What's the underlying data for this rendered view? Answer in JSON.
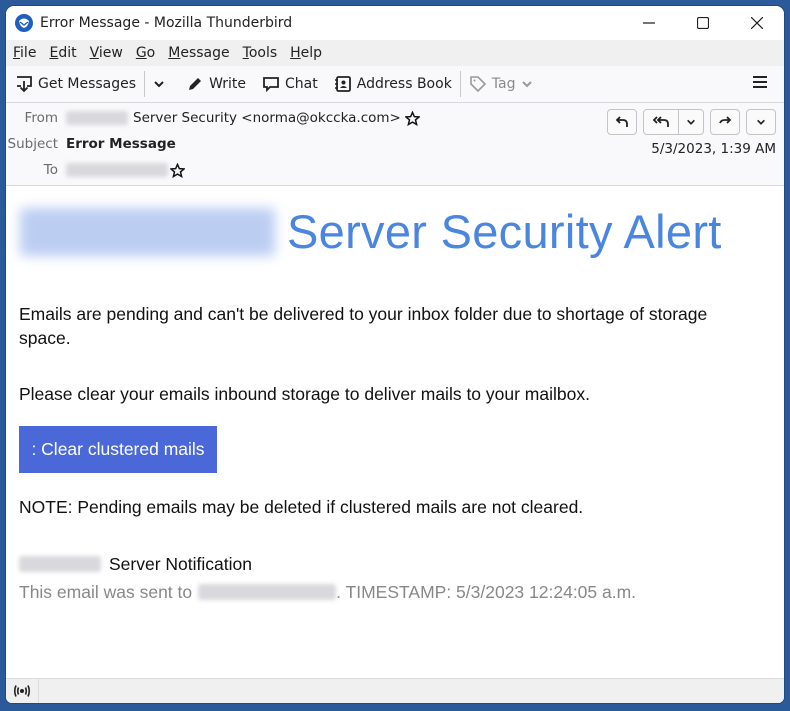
{
  "window": {
    "title": "Error Message - Mozilla Thunderbird"
  },
  "menu": {
    "items": [
      {
        "label": "File",
        "accel": "F",
        "rest": "ile"
      },
      {
        "label": "Edit",
        "accel": "E",
        "rest": "dit"
      },
      {
        "label": "View",
        "accel": "V",
        "rest": "iew"
      },
      {
        "label": "Go",
        "accel": "G",
        "rest": "o"
      },
      {
        "label": "Message",
        "accel": "M",
        "rest": "essage"
      },
      {
        "label": "Tools",
        "accel": "T",
        "rest": "ools"
      },
      {
        "label": "Help",
        "accel": "H",
        "rest": "elp"
      }
    ]
  },
  "toolbar": {
    "get_messages": "Get Messages",
    "write": "Write",
    "chat": "Chat",
    "address_book": "Address Book",
    "tag": "Tag"
  },
  "header": {
    "from_label": "From",
    "from_value": "Server Security <norma@okccka.com>",
    "subject_label": "Subject",
    "subject_value": "Error Message",
    "to_label": "To",
    "date": "5/3/2023, 1:39 AM"
  },
  "email": {
    "title": "Server Security Alert",
    "para1_line1": "Emails are pending and can't be delivered to your inbox folder due to shortage of storage",
    "para1_line2": "space.",
    "para2": "Please clear your emails inbound storage to deliver mails to your mailbox.",
    "button": ": Clear clustered mails",
    "note": "NOTE: Pending emails may be deleted if clustered mails are not cleared.",
    "signature": "Server Notification",
    "footer_prefix": "This email was sent to",
    "footer_suffix": ". TIMESTAMP: 5/3/2023 12:24:05 a.m."
  },
  "colors": {
    "accent": "#4a86e0",
    "button": "#4a68d8",
    "frame": "#2a5a99"
  }
}
